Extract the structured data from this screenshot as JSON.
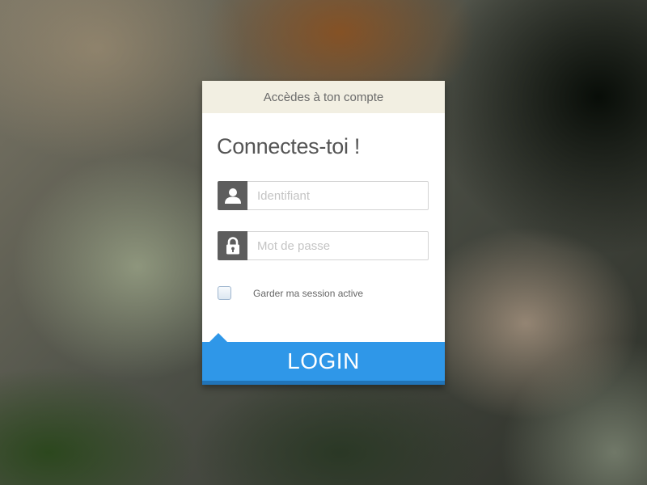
{
  "header": {
    "title": "Accèdes à ton compte"
  },
  "form": {
    "heading": "Connectes-toi !",
    "username": {
      "placeholder": "Identifiant",
      "value": "",
      "icon": "user-icon"
    },
    "password": {
      "placeholder": "Mot de passe",
      "value": "",
      "icon": "lock-icon"
    },
    "remember": {
      "label": "Garder ma session active",
      "checked": false
    },
    "submit_label": "LOGIN"
  },
  "colors": {
    "header_bg": "#f2efe2",
    "icon_box_bg": "#5d5d5d",
    "button_bg": "#2f97e8",
    "button_shadow": "#2174b8"
  }
}
